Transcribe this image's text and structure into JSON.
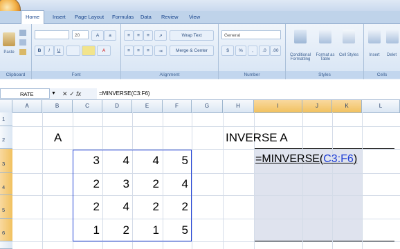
{
  "ribbon": {
    "tabs": [
      "Home",
      "Insert",
      "Page Layout",
      "Formulas",
      "Data",
      "Review",
      "View"
    ],
    "clipboard": {
      "paste": "Paste",
      "label": "Clipboard"
    },
    "font": {
      "size": "20",
      "label": "Font",
      "bold": "B",
      "italic": "I",
      "underline": "U"
    },
    "alignment": {
      "wrap": "Wrap Text",
      "merge": "Merge & Center",
      "label": "Alignment"
    },
    "number": {
      "format": "General",
      "currency": "$",
      "percent": "%",
      "comma": ",",
      "label": "Number"
    },
    "styles": {
      "conditional": "Conditional Formatting",
      "format_table": "Format as Table",
      "cell_styles": "Cell Styles",
      "label": "Styles"
    },
    "cells": {
      "insert": "Insert",
      "delete": "Delet",
      "label": "Cells"
    }
  },
  "formula_bar": {
    "name_box": "RATE",
    "fx": "fx",
    "formula": "=MINVERSE(C3:F6)"
  },
  "columns": [
    "A",
    "B",
    "C",
    "D",
    "E",
    "F",
    "G",
    "H",
    "I",
    "J",
    "K",
    "L"
  ],
  "rows": [
    "1",
    "2",
    "3",
    "4",
    "5",
    "6"
  ],
  "cells": {
    "b2": "A",
    "h2": "INVERSE A",
    "matrix": [
      [
        "3",
        "4",
        "4",
        "5"
      ],
      [
        "2",
        "3",
        "2",
        "4"
      ],
      [
        "2",
        "4",
        "2",
        "2"
      ],
      [
        "1",
        "2",
        "1",
        "5"
      ]
    ],
    "i3_prefix": "=MINVERSE(",
    "i3_ref": "C3:F6",
    "i3_suffix": ")"
  },
  "colors": {
    "ref_blue": "#1f3fd6",
    "selection": "#dfe3ee",
    "header_sel": "#f1c15f"
  }
}
